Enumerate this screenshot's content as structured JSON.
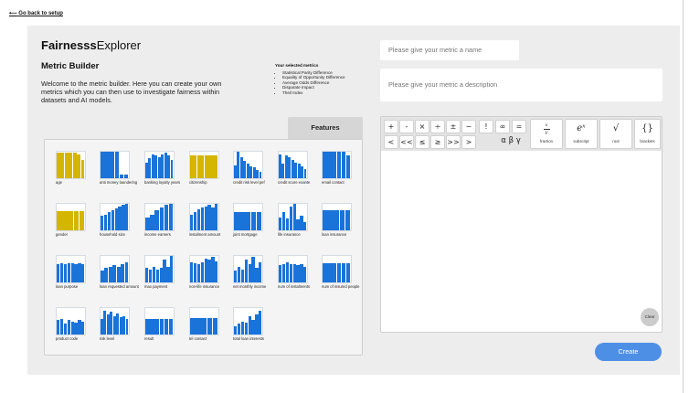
{
  "nav": {
    "back_label": "Go back to setup"
  },
  "app": {
    "title_bold": "Fairnesss",
    "title_rest": "Explorer"
  },
  "builder": {
    "heading": "Metric Builder",
    "intro": "Welcome to the metric builder. Here you can create your own metrics which you can then use to investigate fairness within datasets and AI models."
  },
  "selected": {
    "heading": "Your selected metrics",
    "items": [
      "Statistical Parity Difference",
      "Equality of Opportunity Difference",
      "Average Odds Difference",
      "Disparate Impact",
      "Theil Index"
    ]
  },
  "features_tab": {
    "label": "Features"
  },
  "colors": {
    "blue": "#1a73d9",
    "yellow": "#d4b600",
    "create": "#4e8fe6",
    "background": "#ededed"
  },
  "features": [
    {
      "label": "age",
      "color": "yellow",
      "bars": [
        0.95,
        0.98,
        0.97,
        0.96,
        0.95,
        0.9,
        0.7
      ]
    },
    {
      "label": "anti money laundering",
      "color": "blue",
      "bars": [
        1.0,
        1.0,
        1.0,
        1.0,
        0.15,
        0.15
      ]
    },
    {
      "label": "banking loyalty years",
      "color": "blue",
      "bars": [
        0.6,
        0.75,
        0.9,
        0.85,
        0.8,
        0.9,
        0.95,
        0.85,
        0.7
      ]
    },
    {
      "label": "citizenship",
      "color": "yellow",
      "bars": [
        0.85,
        0.85,
        0.85,
        0.85
      ]
    },
    {
      "label": "credit risk level pef",
      "color": "blue",
      "bars": [
        0.5,
        1.0,
        0.8,
        0.65,
        0.55,
        0.45,
        0.4,
        0.3,
        0.25
      ]
    },
    {
      "label": "credit score exante",
      "color": "blue",
      "bars": [
        0.9,
        0.55,
        0.85,
        0.8,
        0.7,
        0.6,
        0.55,
        0.45,
        0.35
      ]
    },
    {
      "label": "email contact",
      "color": "blue",
      "bars": [
        1.0,
        1.0,
        1.0,
        1.0,
        1.0,
        0.85
      ]
    },
    {
      "label": "gender",
      "color": "yellow",
      "bars": [
        0.72,
        0.72,
        0.72,
        0.72,
        0.72
      ]
    },
    {
      "label": "household size",
      "color": "blue",
      "bars": [
        0.55,
        0.6,
        0.68,
        0.75,
        0.82,
        0.9,
        0.95,
        1.0
      ]
    },
    {
      "label": "income earners",
      "color": "blue",
      "bars": [
        0.5,
        0.6,
        0.75,
        0.85,
        0.95,
        1.0
      ]
    },
    {
      "label": "instalment amount",
      "color": "blue",
      "bars": [
        0.6,
        0.7,
        0.78,
        0.85,
        0.9,
        0.95,
        0.85,
        1.0
      ]
    },
    {
      "label": "joint mortgage",
      "color": "blue",
      "bars": [
        0.7,
        0.7,
        0.7,
        0.7,
        0.7
      ]
    },
    {
      "label": "life insurance",
      "color": "blue",
      "bars": [
        0.5,
        0.7,
        0.45,
        0.9,
        1.0,
        0.4,
        0.55,
        0.3
      ]
    },
    {
      "label": "loan insurance",
      "color": "blue",
      "bars": [
        0.75,
        0.75,
        0.75,
        0.75,
        0.75
      ]
    },
    {
      "label": "loan purpose",
      "color": "blue",
      "bars": [
        0.7,
        0.72,
        0.7,
        0.74,
        0.72,
        0.7,
        0.72,
        0.7
      ]
    },
    {
      "label": "loan requested amount",
      "color": "blue",
      "bars": [
        0.45,
        0.55,
        0.6,
        0.65,
        0.6,
        0.7,
        0.75
      ]
    },
    {
      "label": "max payment",
      "color": "blue",
      "bars": [
        0.55,
        0.5,
        0.6,
        0.5,
        0.55,
        0.85,
        0.6,
        1.0
      ]
    },
    {
      "label": "non-life insurance",
      "color": "blue",
      "bars": [
        0.75,
        0.72,
        0.7,
        0.75,
        0.9,
        0.85,
        0.95,
        0.8
      ]
    },
    {
      "label": "net monthly income",
      "color": "blue",
      "bars": [
        0.45,
        0.6,
        0.5,
        0.85,
        0.7,
        0.95,
        0.55,
        0.75
      ]
    },
    {
      "label": "num of instalments",
      "color": "blue",
      "bars": [
        0.65,
        0.7,
        0.75,
        0.7,
        0.7,
        0.65,
        0.7,
        0.6
      ]
    },
    {
      "label": "num of insured people",
      "color": "blue",
      "bars": [
        0.72,
        0.72,
        0.72,
        0.72,
        0.72,
        0.72
      ]
    },
    {
      "label": "product code",
      "color": "blue",
      "bars": [
        0.55,
        0.6,
        0.4,
        0.55,
        0.5,
        0.45,
        0.55,
        0.5
      ]
    },
    {
      "label": "risk level",
      "color": "blue",
      "bars": [
        0.6,
        0.9,
        0.75,
        0.85,
        0.7,
        0.8,
        0.65,
        0.7,
        0.6
      ]
    },
    {
      "label": "result",
      "color": "blue",
      "bars": [
        0.6,
        0.6,
        0.6,
        0.6,
        0.6,
        0.6
      ]
    },
    {
      "label": "tel contact",
      "color": "blue",
      "bars": [
        0.62,
        0.62,
        0.62,
        0.62,
        0.62
      ]
    },
    {
      "label": "total loan interests",
      "color": "blue",
      "bars": [
        0.3,
        0.4,
        0.5,
        0.45,
        0.7,
        0.55,
        0.75,
        0.9
      ]
    }
  ],
  "metric_form": {
    "name_placeholder": "Please give your metric a name",
    "description_placeholder": "Please give your metric a description"
  },
  "keyboard": {
    "row1": [
      {
        "label": "+",
        "name": "plus-key"
      },
      {
        "label": "-",
        "name": "minus-key"
      },
      {
        "label": "×",
        "name": "multiply-key"
      },
      {
        "label": "÷",
        "name": "divide-key"
      },
      {
        "label": "±",
        "name": "plus-minus-key"
      },
      {
        "label": "~",
        "name": "tilde-key"
      },
      {
        "label": "!",
        "name": "factorial-key"
      },
      {
        "label": "∞",
        "name": "infinity-key"
      },
      {
        "label": "=",
        "name": "equals-key"
      }
    ],
    "row2": [
      {
        "label": "<",
        "name": "less-than-key"
      },
      {
        "label": "<<",
        "name": "much-less-than-key"
      },
      {
        "label": "≤",
        "name": "less-equal-key"
      },
      {
        "label": "≥",
        "name": "greater-equal-key"
      },
      {
        "label": ">>",
        "name": "much-greater-than-key"
      },
      {
        "label": ">",
        "name": "greater-than-key"
      }
    ],
    "greek_label": "α β γ",
    "fraction": {
      "top": "x",
      "bottom": "y",
      "label": "fraction"
    },
    "subscript": {
      "symbol": "eˣ",
      "label": "subscript"
    },
    "root": {
      "symbol": "√",
      "label": "root"
    },
    "brackets": {
      "symbol": "{}",
      "label": "brackets"
    }
  },
  "actions": {
    "clear_label": "Clear",
    "create_label": "Create"
  }
}
